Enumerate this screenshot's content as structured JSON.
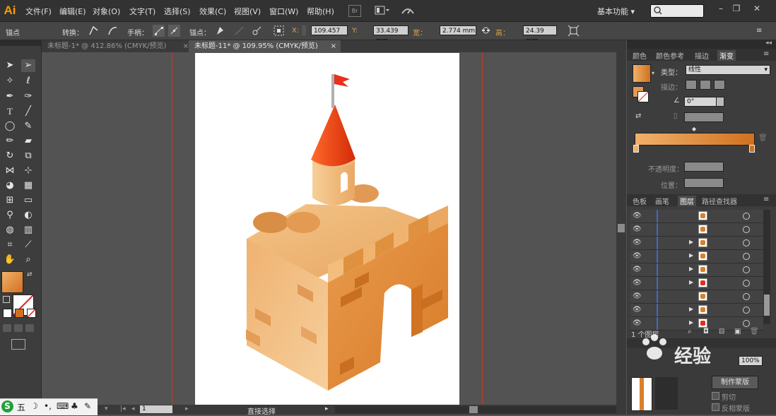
{
  "app": {
    "logo": "Ai"
  },
  "menu": [
    "文件(F)",
    "编辑(E)",
    "对象(O)",
    "文字(T)",
    "选择(S)",
    "效果(C)",
    "视图(V)",
    "窗口(W)",
    "帮助(H)"
  ],
  "workspace": "基本功能",
  "control": {
    "anchor_label": "锚点",
    "convert_label": "转换：",
    "handle_label": "手柄：",
    "anchor2_label": "锚点：",
    "x_label": "X:",
    "x_value": "109.457",
    "y_label": "Y:",
    "y_value": "33.439 mm",
    "w_label": "宽：",
    "w_value": "2.774 mm",
    "h_label": "高：",
    "h_value": "24.39 mm"
  },
  "tabs": [
    {
      "label": "未标题-1* @ 412.86% (CMYK/预览)",
      "close": "×"
    },
    {
      "label": "未标题-11* @ 109.95% (CMYK/预览)",
      "close": "×"
    }
  ],
  "gradient_panel": {
    "tabs": [
      "颜色",
      "颜色参考",
      "描边",
      "渐变"
    ],
    "type_label": "类型：",
    "type_value": "线性",
    "stroke_label": "描边：",
    "angle_value": "0°",
    "opacity_label": "不透明度：",
    "position_label": "位置：",
    "colors": {
      "start": "#f0b16a",
      "end": "#d1711f"
    }
  },
  "layers_panel": {
    "tabs": [
      "色板",
      "画笔",
      "图层",
      "路径查找器"
    ],
    "row_count": 9,
    "footer": "1 个图层"
  },
  "lower_panel": {
    "clip_label": "剪切",
    "invert_label": "反相蒙版",
    "mask_button": "制作蒙版",
    "opacity_value": "100%"
  },
  "status": {
    "zoom": "1",
    "tool": "直接选择"
  },
  "watermark": "经验",
  "ime": {
    "label": "五"
  }
}
